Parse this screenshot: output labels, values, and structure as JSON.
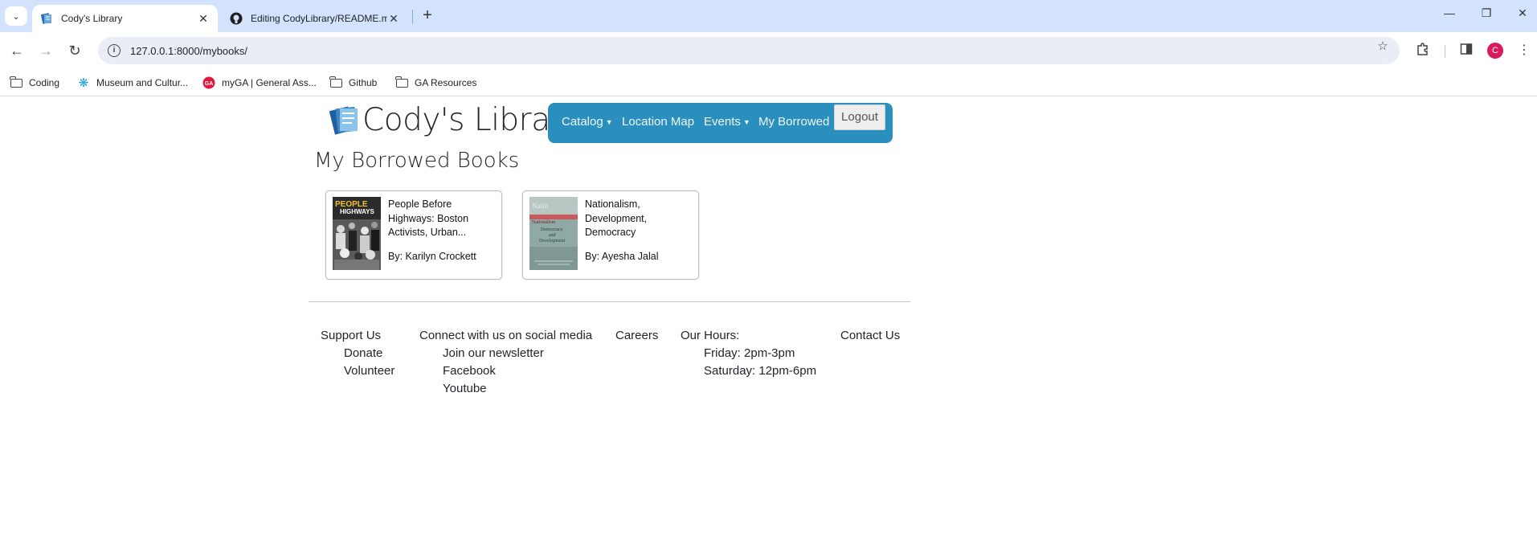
{
  "browser": {
    "tabs": [
      {
        "title": "Cody's Library",
        "active": true
      },
      {
        "title": "Editing CodyLibrary/README.m",
        "active": false
      }
    ],
    "url": "127.0.0.1:8000/mybooks/",
    "avatar_letter": "C",
    "bookmarks": [
      {
        "label": "Coding",
        "icon": "folder-icon"
      },
      {
        "label": "Museum and Cultur...",
        "icon": "snowflake-icon"
      },
      {
        "label": "myGA | General Ass...",
        "icon": "ga-icon"
      },
      {
        "label": "Github",
        "icon": "folder-icon"
      },
      {
        "label": "GA Resources",
        "icon": "folder-icon"
      }
    ]
  },
  "site": {
    "title": "Cody's Library",
    "nav": {
      "catalog": "Catalog",
      "location_map": "Location Map",
      "events": "Events",
      "my_borrowed": "My Borrowed",
      "logout": "Logout"
    },
    "brand_color": "#2a8fbd"
  },
  "page": {
    "heading": "My Borrowed Books",
    "books": [
      {
        "title": "People Before Highways: Boston Activists, Urban...",
        "author": "By: Karilyn Crockett",
        "cover_text": "PEOPLE HIGHWAYS"
      },
      {
        "title": "Nationalism, Development, Democracy",
        "author": "By: Ayesha Jalal",
        "cover_text": "Nationalism Development and Democracy"
      }
    ]
  },
  "footer": {
    "support": {
      "heading": "Support Us",
      "links": [
        "Donate",
        "Volunteer"
      ]
    },
    "social": {
      "heading": "Connect with us on social media",
      "links": [
        "Join our newsletter",
        "Facebook",
        "Youtube"
      ]
    },
    "careers": {
      "heading": "Careers"
    },
    "hours": {
      "heading": "Our Hours:",
      "lines": [
        "Friday: 2pm-3pm",
        "Saturday: 12pm-6pm"
      ]
    },
    "contact": {
      "heading": "Contact Us"
    }
  }
}
